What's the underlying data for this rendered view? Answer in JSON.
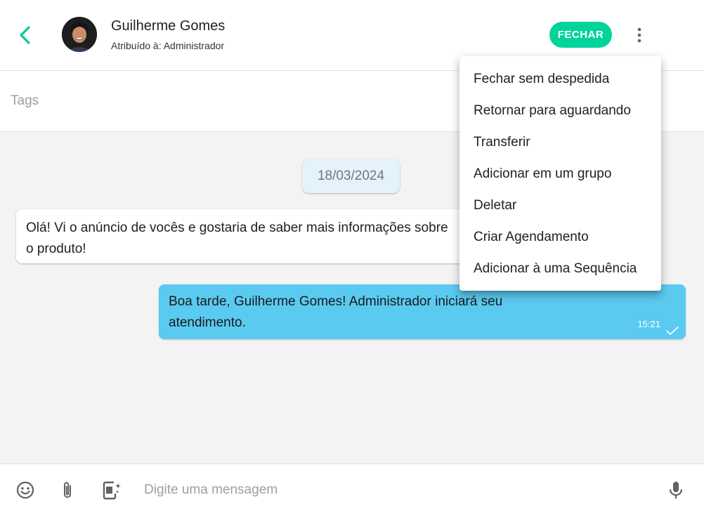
{
  "header": {
    "contact_name": "Guilherme Gomes",
    "assigned_text": "Atribuído à: Administrador",
    "close_label": "FECHAR",
    "accent_color": "#00d49a"
  },
  "tags": {
    "placeholder": "Tags"
  },
  "chat": {
    "date": "18/03/2024",
    "incoming": {
      "text": "Olá! Vi o anúncio de vocês e gostaria de saber mais informações sobre o produto!"
    },
    "outgoing": {
      "text": "Boa tarde, Guilherme Gomes! Administrador iniciará seu atendimento.",
      "time": "15:21",
      "status_icon": "check-icon",
      "bubble_color": "#5bcaf1"
    }
  },
  "menu": {
    "items": [
      {
        "label": "Fechar sem despedida"
      },
      {
        "label": "Retornar para aguardando"
      },
      {
        "label": "Transferir"
      },
      {
        "label": "Adicionar em um grupo"
      },
      {
        "label": "Deletar"
      },
      {
        "label": "Criar Agendamento"
      },
      {
        "label": "Adicionar à uma Sequência"
      }
    ]
  },
  "composer": {
    "placeholder": "Digite uma mensagem",
    "icons": [
      "emoji-icon",
      "paperclip-icon",
      "template-icon",
      "microphone-icon"
    ]
  }
}
